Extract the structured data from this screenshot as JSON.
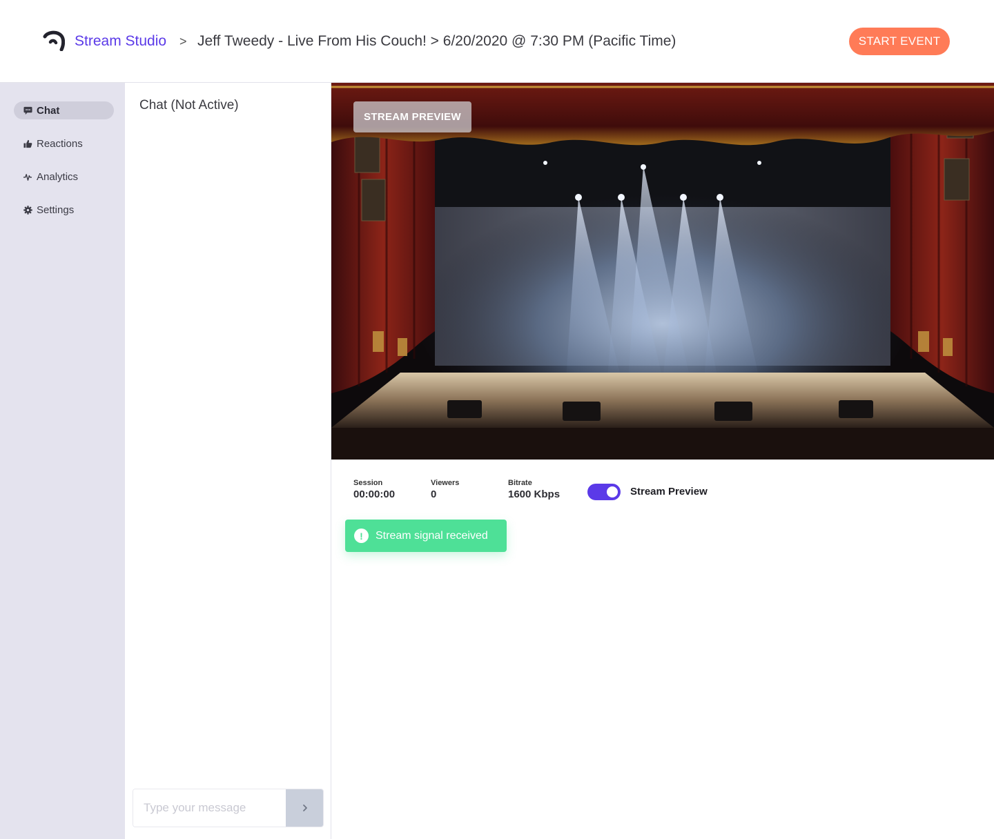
{
  "header": {
    "breadcrumb_studio": "Stream Studio",
    "breadcrumb_separator": ">",
    "event_title": "Jeff Tweedy - Live From His Couch! > 6/20/2020 @ 7:30 PM (Pacific Time)",
    "start_button": "START EVENT"
  },
  "sidebar": {
    "items": [
      {
        "label": "Chat",
        "icon": "chat-bubble-icon",
        "active": true
      },
      {
        "label": "Reactions",
        "icon": "thumbs-up-icon",
        "active": false
      },
      {
        "label": "Analytics",
        "icon": "pulse-icon",
        "active": false
      },
      {
        "label": "Settings",
        "icon": "gear-icon",
        "active": false
      }
    ]
  },
  "chat": {
    "title": "Chat (Not Active)",
    "placeholder": "Type your message",
    "send_icon": "chevron-right-icon"
  },
  "preview": {
    "label": "STREAM PREVIEW",
    "image": "theater stage with curtains, spotlights and smoke"
  },
  "stats": {
    "session_label": "Session",
    "session_value": "00:00:00",
    "viewers_label": "Viewers",
    "viewers_value": "0",
    "bitrate_label": "Bitrate",
    "bitrate_value": "1600 Kbps"
  },
  "stream_preview_toggle": {
    "label": "Stream Preview",
    "on": true
  },
  "signal": {
    "message": "Stream signal received",
    "icon": "exclamation-circle-icon"
  },
  "colors": {
    "brand": "#5b3ae8",
    "start_button": "#ff7b57",
    "success": "#4ee097",
    "sidebar_bg": "#e4e3ee"
  }
}
